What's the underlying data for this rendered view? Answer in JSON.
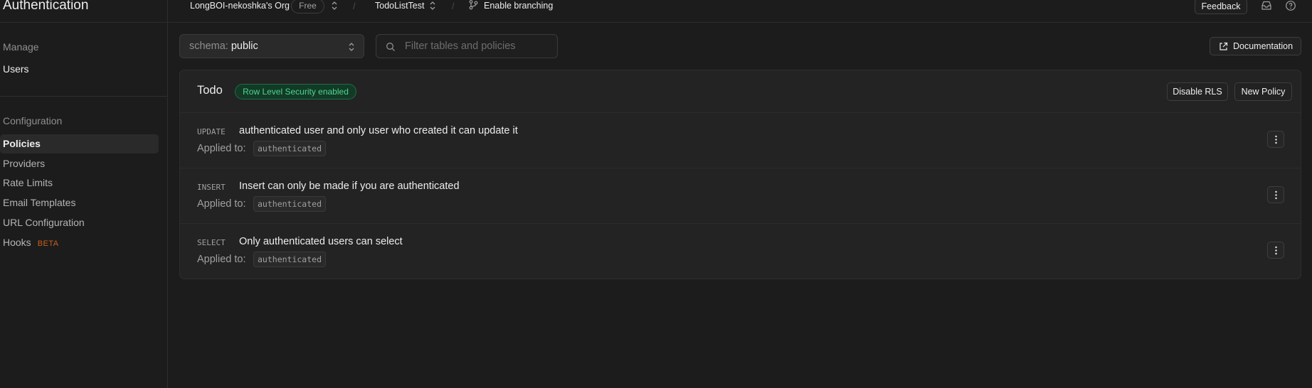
{
  "sidebar": {
    "title": "Authentication",
    "manage_label": "Manage",
    "manage_items": [
      {
        "label": "Users"
      }
    ],
    "config_label": "Configuration",
    "config_items": [
      {
        "label": "Policies"
      },
      {
        "label": "Providers"
      },
      {
        "label": "Rate Limits"
      },
      {
        "label": "Email Templates"
      },
      {
        "label": "URL Configuration"
      },
      {
        "label": "Hooks",
        "badge": "BETA"
      }
    ]
  },
  "topbar": {
    "org": "LongBOI-nekoshka's Org",
    "plan": "Free",
    "project": "TodoListTest",
    "branching": "Enable branching",
    "feedback": "Feedback"
  },
  "controls": {
    "schema_label": "schema:",
    "schema_value": "public",
    "filter_placeholder": "Filter tables and policies",
    "documentation": "Documentation"
  },
  "table": {
    "name": "Todo",
    "rls_badge": "Row Level Security enabled",
    "disable_rls": "Disable RLS",
    "new_policy": "New Policy",
    "applied_label": "Applied to:",
    "policies": [
      {
        "command": "UPDATE",
        "name": "authenticated user and only user who created it can update it",
        "role": "authenticated"
      },
      {
        "command": "INSERT",
        "name": "Insert can only be made if you are authenticated",
        "role": "authenticated"
      },
      {
        "command": "SELECT",
        "name": "Only authenticated users can select",
        "role": "authenticated"
      }
    ]
  },
  "colors": {
    "background": "#1c1c1c",
    "card": "#232323",
    "rls_green": "#4fd68c",
    "beta_orange": "#c8601e"
  }
}
